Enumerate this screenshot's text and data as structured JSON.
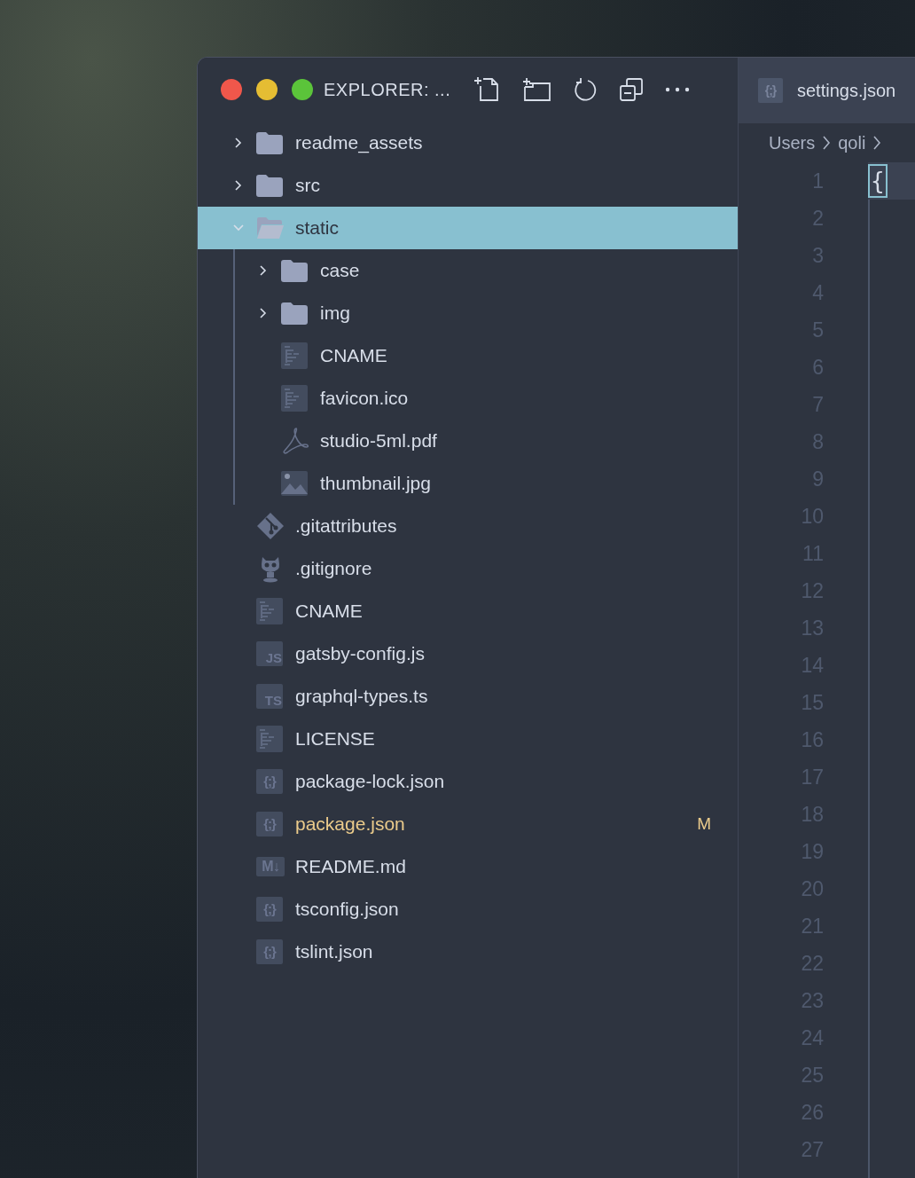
{
  "explorer": {
    "title": "EXPLORER: ...",
    "tree": [
      {
        "name": "readme_assets",
        "kind": "folder",
        "expanded": false,
        "selected": false
      },
      {
        "name": "src",
        "kind": "folder",
        "expanded": false,
        "selected": false
      },
      {
        "name": "static",
        "kind": "folder",
        "expanded": true,
        "selected": true,
        "children": [
          {
            "name": "case",
            "kind": "folder",
            "expanded": false,
            "selected": false
          },
          {
            "name": "img",
            "kind": "folder",
            "expanded": false,
            "selected": false
          },
          {
            "name": "CNAME",
            "kind": "text",
            "selected": false
          },
          {
            "name": "favicon.ico",
            "kind": "text",
            "selected": false
          },
          {
            "name": "studio-5ml.pdf",
            "kind": "pdf",
            "selected": false
          },
          {
            "name": "thumbnail.jpg",
            "kind": "image",
            "selected": false
          }
        ]
      },
      {
        "name": ".gitattributes",
        "kind": "git",
        "selected": false
      },
      {
        "name": ".gitignore",
        "kind": "github",
        "selected": false
      },
      {
        "name": "CNAME",
        "kind": "text",
        "selected": false
      },
      {
        "name": "gatsby-config.js",
        "kind": "code",
        "icon_label": "JS",
        "selected": false
      },
      {
        "name": "graphql-types.ts",
        "kind": "code",
        "icon_label": "TS",
        "selected": false
      },
      {
        "name": "LICENSE",
        "kind": "text",
        "selected": false
      },
      {
        "name": "package-lock.json",
        "kind": "json",
        "icon_label": "{;}",
        "selected": false
      },
      {
        "name": "package.json",
        "kind": "json",
        "icon_label": "{;}",
        "selected": false,
        "modified": true,
        "badge": "M"
      },
      {
        "name": "README.md",
        "kind": "markdown",
        "icon_label": "M↓",
        "selected": false
      },
      {
        "name": "tsconfig.json",
        "kind": "json",
        "icon_label": "{;}",
        "selected": false
      },
      {
        "name": "tslint.json",
        "kind": "json",
        "icon_label": "{;}",
        "selected": false
      }
    ]
  },
  "editor": {
    "tab": {
      "title": "settings.json",
      "icon_label": "{;}",
      "selected": true
    },
    "breadcrumb": [
      "Users",
      "qoli"
    ],
    "line_numbers": [
      "1",
      "2",
      "3",
      "4",
      "5",
      "6",
      "7",
      "8",
      "9",
      "10",
      "11",
      "12",
      "13",
      "14",
      "15",
      "16",
      "17",
      "18",
      "19",
      "20",
      "21",
      "22",
      "23",
      "24",
      "25",
      "26",
      "27"
    ],
    "lines": [
      "{"
    ]
  }
}
